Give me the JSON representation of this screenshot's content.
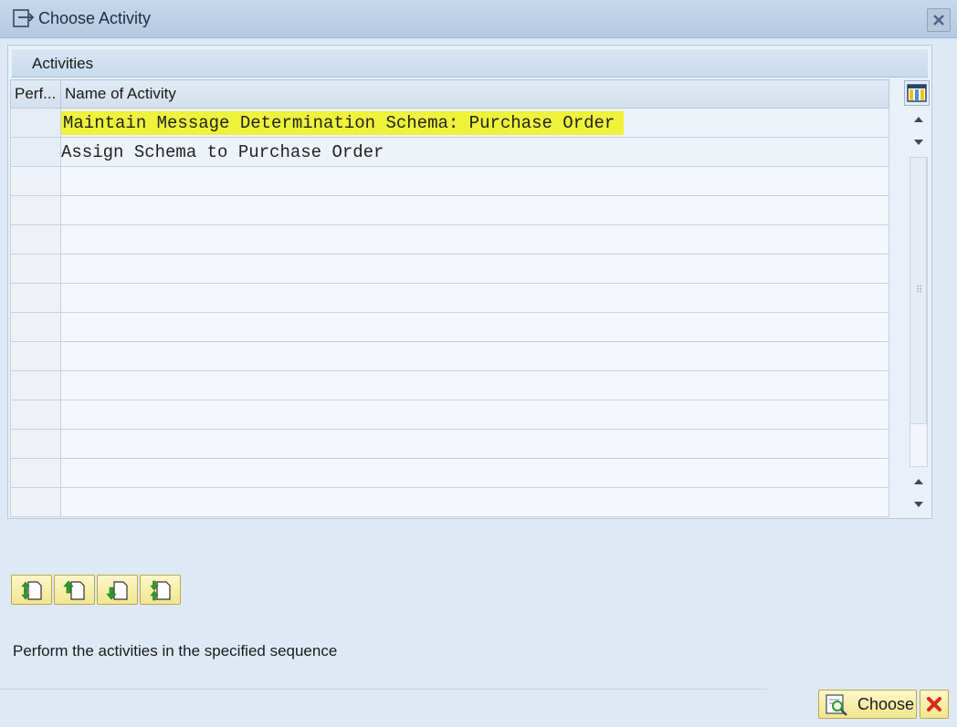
{
  "window": {
    "title": "Choose Activity",
    "close_icon": "close-icon",
    "window_icon": "choose-window-icon"
  },
  "panel": {
    "header": "Activities",
    "columns": [
      "Perf...",
      "Name of Activity"
    ],
    "rows": [
      {
        "perf": "",
        "name": "Maintain Message Determination Schema: Purchase Order",
        "highlighted": true
      },
      {
        "perf": "",
        "name": "Assign Schema to Purchase Order",
        "highlighted": false
      }
    ],
    "highlight_color": "#eef23a"
  },
  "toolbar": {
    "buttons": [
      {
        "name": "select-all-button",
        "icon": "select-all-icon"
      },
      {
        "name": "move-up-button",
        "icon": "arrow-up-doc-icon"
      },
      {
        "name": "move-down-button",
        "icon": "arrow-down-doc-icon"
      },
      {
        "name": "deselect-all-button",
        "icon": "deselect-all-icon"
      }
    ]
  },
  "status": {
    "text": "Perform the activities in the specified sequence"
  },
  "footer": {
    "choose_label": "Choose",
    "choose_icon": "choose-icon",
    "cancel_icon": "cancel-icon",
    "accent_color": "#f2e58f"
  }
}
